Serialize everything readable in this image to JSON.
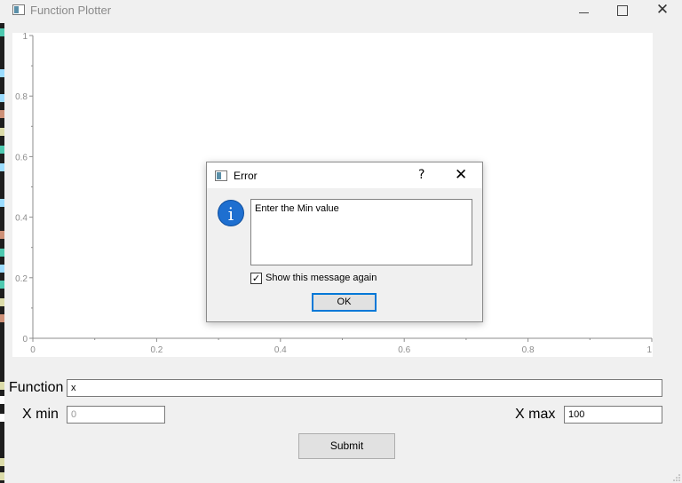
{
  "window": {
    "title": "Function Plotter",
    "minimize_glyph": "—",
    "maximize_glyph": "☐",
    "close_glyph": "✕"
  },
  "plot": {
    "y_ticks": [
      "0",
      "0.2",
      "0.4",
      "0.6",
      "0.8",
      "1"
    ],
    "x_ticks": [
      "0",
      "0.2",
      "0.4",
      "0.6",
      "0.8",
      "1"
    ]
  },
  "form": {
    "function_label": "Function",
    "function_value": "x",
    "xmin_label": "X min",
    "xmin_placeholder": "0",
    "xmax_label": "X max",
    "xmax_value": "100",
    "submit_label": "Submit"
  },
  "dialog": {
    "title": "Error",
    "help_glyph": "?",
    "close_glyph": "✕",
    "message": "Enter the Min value",
    "checkbox_label": "Show this message again",
    "checkbox_checked": true,
    "ok_label": "OK",
    "info_glyph": "i"
  },
  "colors": {
    "accent": "#0078d7",
    "info_icon": "#1e6fd0",
    "axis": "#8c8c8c"
  }
}
